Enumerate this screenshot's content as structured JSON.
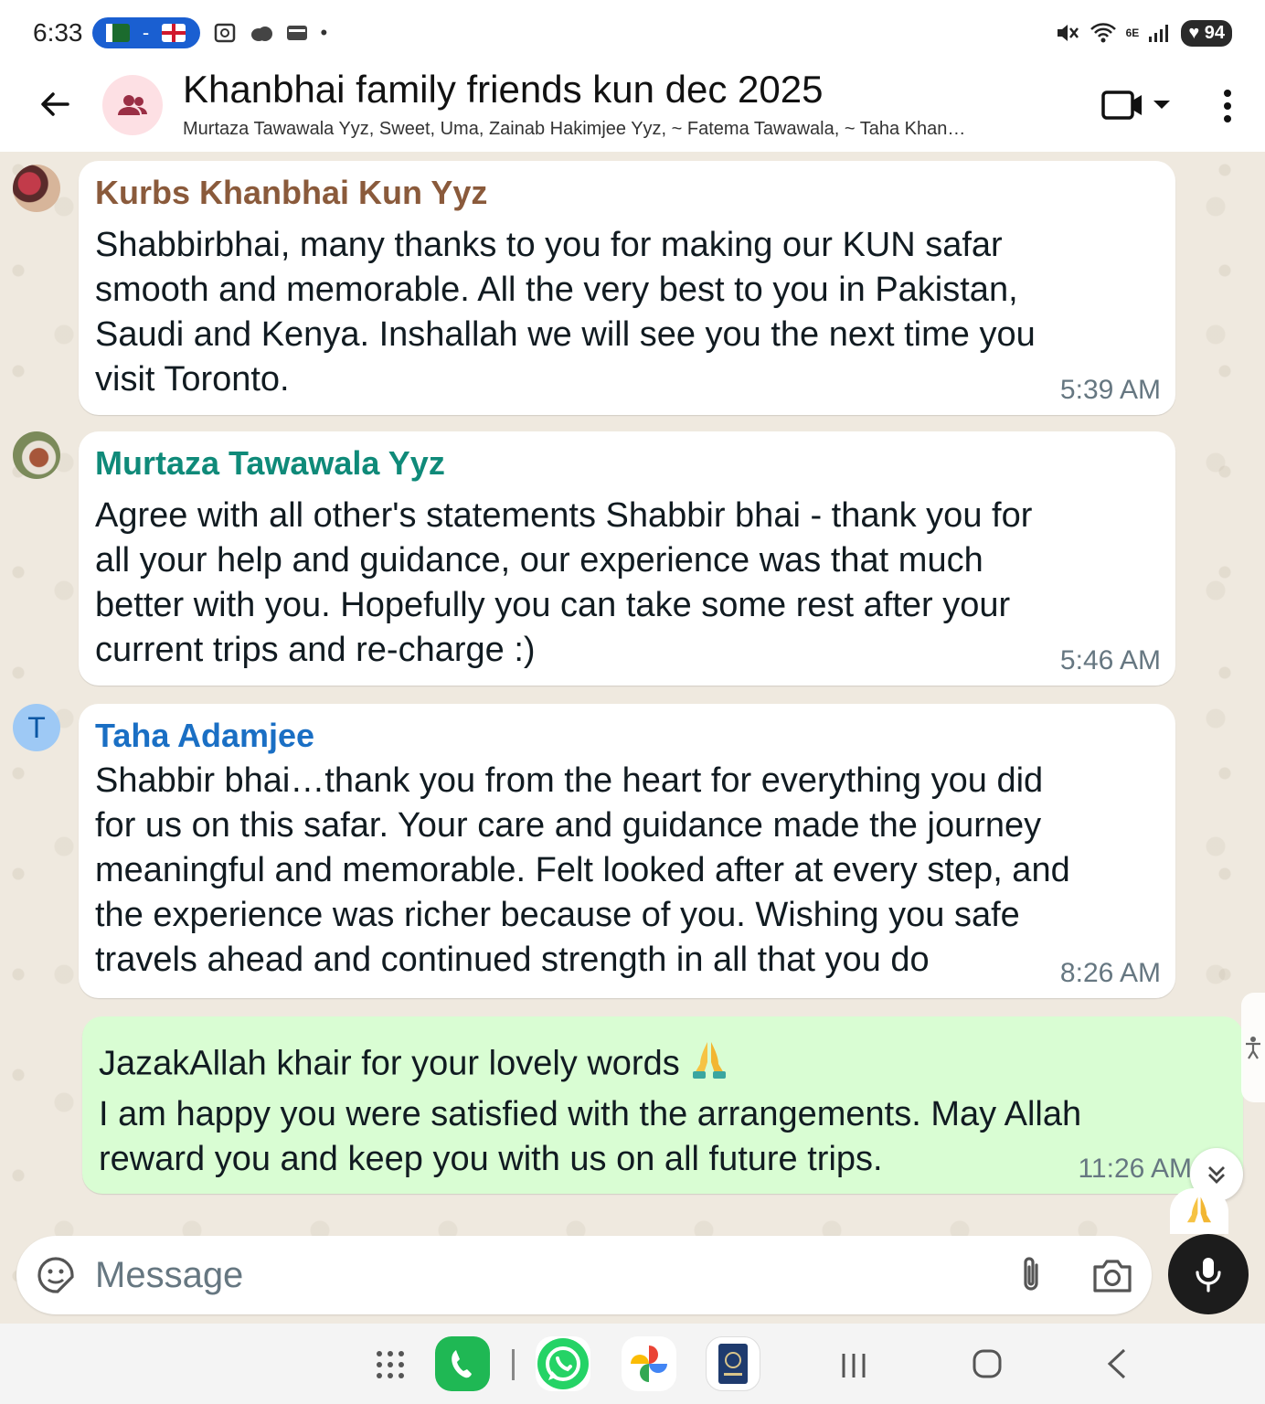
{
  "status_bar": {
    "time": "6:33",
    "pill_separator": "-",
    "network": "6E",
    "battery": "94"
  },
  "header": {
    "title": "Khanbhai family friends kun dec 2025",
    "subtitle": "Murtaza Tawawala Yyz, Sweet, Uma, Zainab Hakimjee Yyz, ~ Fatema Tawawala, ~ Taha Khan…"
  },
  "messages": [
    {
      "sender": "Kurbs Khanbhai Kun Yyz",
      "sender_color": "#8a5a3b",
      "text": "Shabbirbhai, many thanks to you for making our KUN safar\nsmooth and memorable.  All the very best to you in Pakistan,\nSaudi and Kenya.  Inshallah we will see you the next time you\nvisit Toronto.",
      "time": "5:39 AM"
    },
    {
      "sender": "Murtaza Tawawala Yyz",
      "sender_color": "#0f8a79",
      "text": "Agree with all other's statements Shabbir bhai - thank you for\nall your help and guidance, our experience was that much\nbetter with you. Hopefully you can take some rest after your\ncurrent trips and re-charge :)",
      "time": "5:46 AM"
    },
    {
      "sender": "Taha Adamjee",
      "avatar_letter": "T",
      "sender_color": "#1a6fc4",
      "text": "Shabbir bhai…thank you from the heart for everything you did\nfor us on this safar. Your care and guidance made the journey\nmeaningful and memorable. Felt looked after at every step, and\nthe experience was richer because of you. Wishing you safe\ntravels ahead and continued strength in all that you do",
      "time": "8:26 AM"
    },
    {
      "line1": "JazakAllah khair for your lovely words",
      "text": "I am happy you were satisfied with the arrangements. May Allah\nreward you and keep you with us on all future trips.",
      "time": "11:26 AM",
      "reaction": "folded-hands",
      "bubble_color": "#d9fdd3"
    }
  ],
  "composer": {
    "placeholder": "Message"
  },
  "icons": {
    "back": "arrow-left-icon",
    "group": "group-icon",
    "video": "video-camera-icon",
    "menu": "more-vert-icon",
    "emoji": "sticker-icon",
    "attach": "paperclip-icon",
    "camera": "camera-icon",
    "mic": "mic-icon"
  }
}
